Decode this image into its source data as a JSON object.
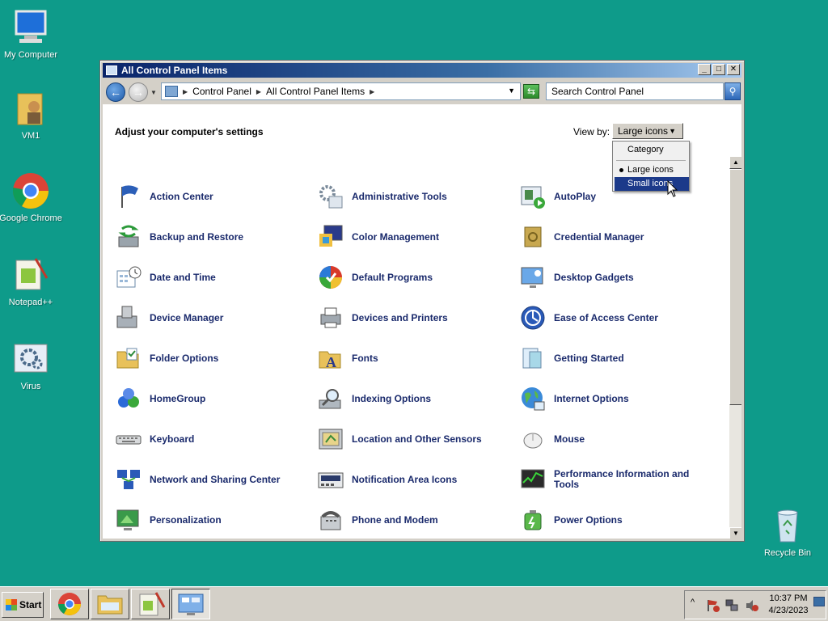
{
  "desktop": {
    "icons": [
      {
        "label": "My Computer",
        "icon": "computer-icon"
      },
      {
        "label": "VM1",
        "icon": "user-folder-icon"
      },
      {
        "label": "Google Chrome",
        "icon": "chrome-icon"
      },
      {
        "label": "Notepad++",
        "icon": "notepad-plus-plus-icon"
      },
      {
        "label": "Virus",
        "icon": "gear-settings-icon"
      },
      {
        "label": "Recycle Bin",
        "icon": "recycle-bin-icon"
      }
    ]
  },
  "window": {
    "title": "All Control Panel Items",
    "controls": {
      "minimize": "_",
      "maximize": "□",
      "close": "✕"
    },
    "breadcrumb": [
      "Control Panel",
      "All Control Panel Items"
    ],
    "search_placeholder": "Search Control Panel",
    "heading": "Adjust your computer's settings",
    "view_by_label": "View by:",
    "view_by_value": "Large icons",
    "view_menu": {
      "options": [
        "Category",
        "Large icons",
        "Small icons"
      ],
      "selected": "Large icons",
      "highlighted": "Small icons"
    },
    "items": [
      {
        "label": "Action Center",
        "icon": "flag-icon"
      },
      {
        "label": "Administrative Tools",
        "icon": "admin-tools-icon"
      },
      {
        "label": "AutoPlay",
        "icon": "autoplay-icon"
      },
      {
        "label": "Backup and Restore",
        "icon": "backup-icon"
      },
      {
        "label": "Color Management",
        "icon": "color-management-icon"
      },
      {
        "label": "Credential Manager",
        "icon": "credential-vault-icon"
      },
      {
        "label": "Date and Time",
        "icon": "calendar-clock-icon"
      },
      {
        "label": "Default Programs",
        "icon": "default-programs-icon"
      },
      {
        "label": "Desktop Gadgets",
        "icon": "gadgets-icon"
      },
      {
        "label": "Device Manager",
        "icon": "device-manager-icon"
      },
      {
        "label": "Devices and Printers",
        "icon": "printer-icon"
      },
      {
        "label": "Ease of Access Center",
        "icon": "ease-of-access-icon"
      },
      {
        "label": "Folder Options",
        "icon": "folder-options-icon"
      },
      {
        "label": "Fonts",
        "icon": "fonts-folder-icon"
      },
      {
        "label": "Getting Started",
        "icon": "getting-started-icon"
      },
      {
        "label": "HomeGroup",
        "icon": "homegroup-icon"
      },
      {
        "label": "Indexing Options",
        "icon": "indexing-icon"
      },
      {
        "label": "Internet Options",
        "icon": "globe-icon"
      },
      {
        "label": "Keyboard",
        "icon": "keyboard-icon"
      },
      {
        "label": "Location and Other Sensors",
        "icon": "sensors-icon"
      },
      {
        "label": "Mouse",
        "icon": "mouse-icon"
      },
      {
        "label": "Network and Sharing Center",
        "icon": "network-icon"
      },
      {
        "label": "Notification Area Icons",
        "icon": "notification-icon"
      },
      {
        "label": "Performance Information and Tools",
        "icon": "performance-icon"
      },
      {
        "label": "Personalization",
        "icon": "personalization-icon"
      },
      {
        "label": "Phone and Modem",
        "icon": "phone-icon"
      },
      {
        "label": "Power Options",
        "icon": "battery-icon"
      }
    ]
  },
  "taskbar": {
    "start_label": "Start",
    "apps": [
      "chrome-icon",
      "explorer-icon",
      "notepad-plus-plus-icon",
      "control-panel-icon"
    ],
    "clock_time": "10:37 PM",
    "clock_date": "4/23/2023"
  },
  "colors": {
    "desktop_bg": "#0e9b8a",
    "item_text": "#1a2a6c",
    "menu_highlight": "#1c3a8a"
  }
}
